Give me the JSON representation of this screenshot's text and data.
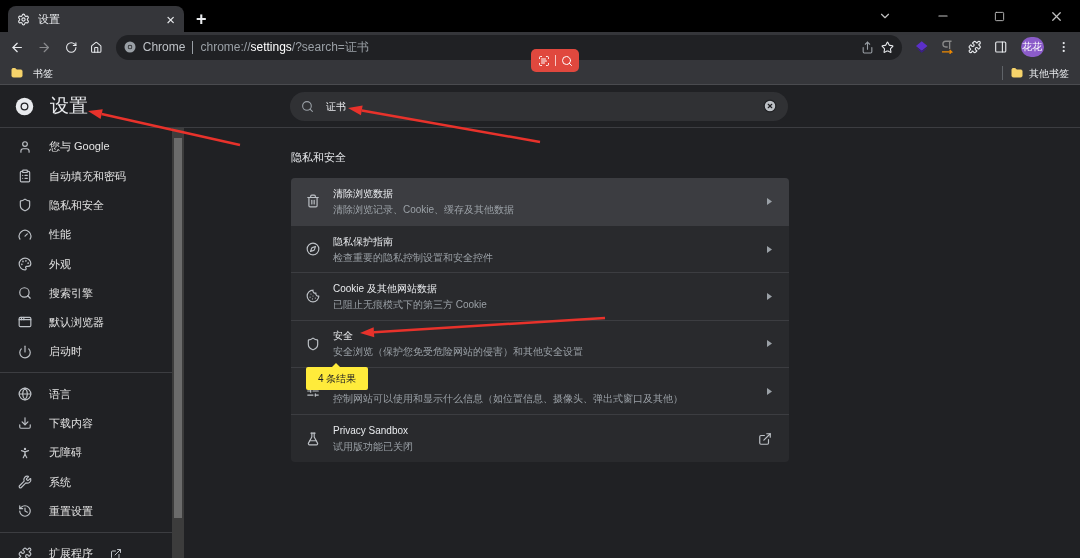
{
  "tab": {
    "title": "设置",
    "close": "×",
    "new_tab": "+"
  },
  "address": {
    "site": "Chrome",
    "url_prefix": "chrome://",
    "url_host": "settings",
    "url_rest": "/?search=证书"
  },
  "profile": {
    "initials": "花花"
  },
  "bookmarks": [
    {
      "label": "书签"
    },
    {
      "label": "其他书签"
    }
  ],
  "header": {
    "title": "设置"
  },
  "search": {
    "value": "证书"
  },
  "sidebar": {
    "groups": [
      [
        {
          "kind": "person",
          "label": "您与 Google"
        },
        {
          "kind": "clipboard",
          "label": "自动填充和密码"
        },
        {
          "kind": "shield",
          "label": "隐私和安全"
        },
        {
          "kind": "gauge",
          "label": "性能"
        },
        {
          "kind": "palette",
          "label": "外观"
        },
        {
          "kind": "search",
          "label": "搜索引擎"
        },
        {
          "kind": "browser",
          "label": "默认浏览器"
        },
        {
          "kind": "power",
          "label": "启动时"
        }
      ],
      [
        {
          "kind": "globe",
          "label": "语言"
        },
        {
          "kind": "download",
          "label": "下载内容"
        },
        {
          "kind": "accessibility",
          "label": "无障碍"
        },
        {
          "kind": "wrench",
          "label": "系统"
        },
        {
          "kind": "history",
          "label": "重置设置"
        }
      ],
      [
        {
          "kind": "puzzle",
          "label": "扩展程序",
          "external": true
        }
      ]
    ]
  },
  "section": {
    "title": "隐私和安全"
  },
  "rows": [
    {
      "kind": "trash",
      "title": "清除浏览数据",
      "subtitle": "清除浏览记录、Cookie、缓存及其他数据",
      "hovered": true,
      "external": false
    },
    {
      "kind": "compass",
      "title": "隐私保护指南",
      "subtitle": "检查重要的隐私控制设置和安全控件",
      "hovered": false,
      "external": false
    },
    {
      "kind": "cookie",
      "title": "Cookie 及其他网站数据",
      "subtitle": "已阻止无痕模式下的第三方 Cookie",
      "hovered": false,
      "external": false
    },
    {
      "kind": "shield",
      "title": "安全",
      "subtitle": "安全浏览（保护您免受危险网站的侵害）和其他安全设置",
      "hovered": false,
      "external": false
    },
    {
      "kind": "sliders",
      "subtitle": "控制网站可以使用和显示什么信息（如位置信息、摄像头、弹出式窗口及其他）",
      "hovered": false,
      "external": false
    },
    {
      "kind": "flask",
      "title": "Privacy Sandbox",
      "subtitle": "试用版功能已关闭",
      "hovered": false,
      "external": true
    }
  ],
  "result_tooltip": {
    "text": "4 条结果"
  }
}
